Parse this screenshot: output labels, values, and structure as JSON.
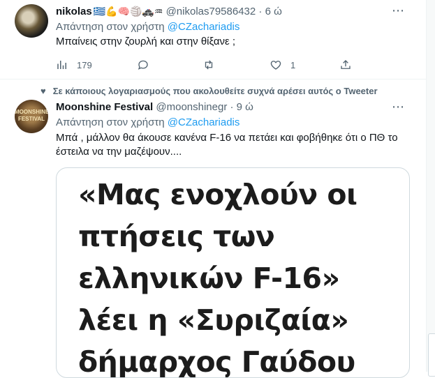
{
  "tweets": [
    {
      "name": "nikolas",
      "name_emojis": "🇬🇷💪🧠🏐🚓♒",
      "handle": "@nikolas79586432",
      "time": "6 ώ",
      "reply_prefix": "Απάντηση στον χρήστη",
      "reply_mention": "@CZachariadis",
      "text": "Μπαίνεις στην ζουρλή και στην θίξανε ;",
      "stats": {
        "views": "179",
        "likes": "1"
      }
    },
    {
      "social_context": "Σε κάποιους λογαριασμούς που ακολουθείτε συχνά αρέσει αυτός ο Tweeter",
      "name": "Moonshine Festival",
      "handle": "@moonshinegr",
      "time": "9 ώ",
      "avatar_text": [
        "MOONSHINE",
        "FESTIVAL"
      ],
      "reply_prefix": "Απάντηση στον χρήστη",
      "reply_mention": "@CZachariadis",
      "text": "Μπά , μάλλον θα άκουσε κανένα F-16 να πετάει και φοβήθηκε ότι ο ΠΘ το έστειλα να την μαζέψουν....",
      "media_text": "«Μας ενοχλούν οι πτήσεις των ελληνικών F-16» λέει η «Συριζαία» δήμαρχος Γαύδου"
    }
  ],
  "more_icon": "⋯",
  "dot": "·",
  "colors": {
    "accent": "#1d9bf0",
    "muted": "#536471",
    "text": "#0f1419",
    "border": "#eff3f4"
  }
}
